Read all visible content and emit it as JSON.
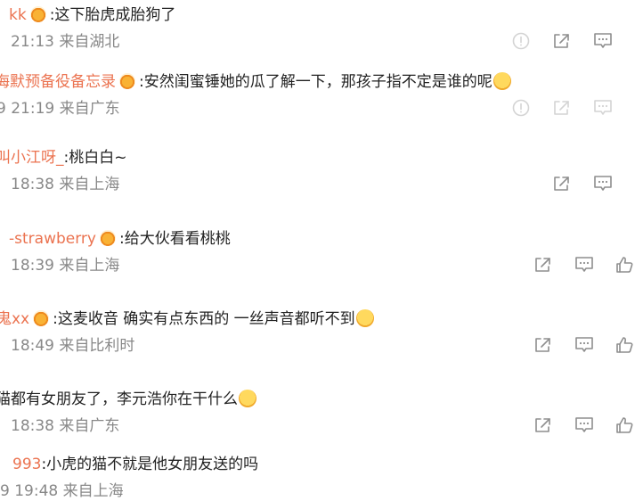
{
  "comments": [
    {
      "user": "kk",
      "text": ":这下胎虎成胎狗了",
      "time": "21:13 来自湖北"
    },
    {
      "user": "海默预备役备忘录",
      "text": ":安然闺蜜锤她的瓜了解一下，那孩子指不定是谁的呢",
      "time": "9 21:19 来自广东"
    },
    {
      "user": "叫小江呀_",
      "text": ":桃白白~",
      "time": "18:38 来自上海"
    },
    {
      "user": "-strawberry",
      "text": ":给大伙看看桃桃",
      "time": "18:39 来自上海"
    },
    {
      "user": "鬼xx",
      "text": ":这麦收音 确实有点东西的 一丝声音都听不到",
      "time": "18:49 来自比利时"
    },
    {
      "user": "",
      "text": "猫都有女朋友了，李元浩你在干什么",
      "time": "18:38 来自广东"
    },
    {
      "user": "993",
      "text": ":小虎的猫不就是他女朋友送的吗",
      "time": "9 19:48 来自上海"
    }
  ],
  "icons": [
    "report-icon",
    "share-icon",
    "comment-icon",
    "like-icon"
  ],
  "colors": {
    "username": "#eb7350",
    "text": "#222222",
    "meta": "#888888",
    "icon": "#8e8e8e",
    "icon_faded": "#d4d4d4"
  }
}
